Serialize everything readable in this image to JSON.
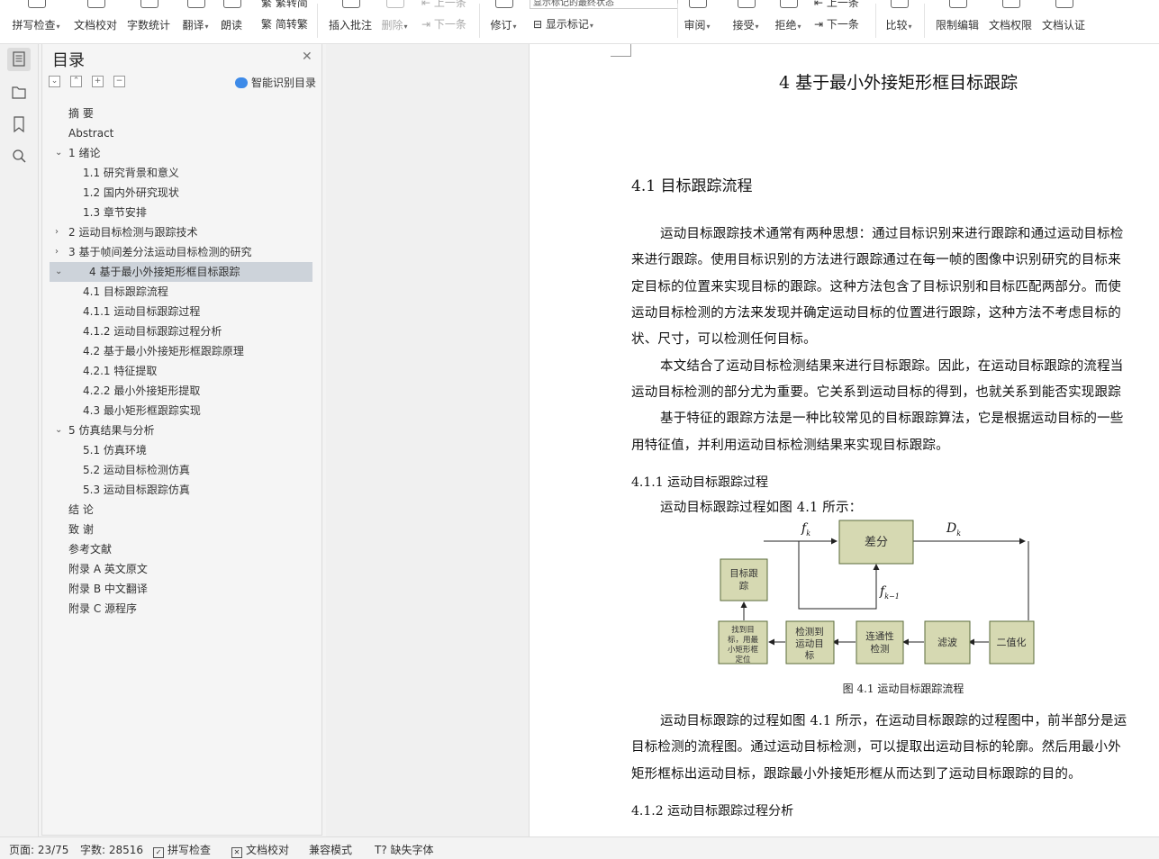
{
  "ribbon": {
    "spell_check": "拼写检查",
    "proofread": "文档校对",
    "word_count": "字数统计",
    "translate": "翻译",
    "read_aloud": "朗读",
    "simp_trad_top": "繁转简",
    "trad_to_simp": "简转繁",
    "insert_comment": "插入批注",
    "delete": "删除",
    "prev": "上一条",
    "next_comment": "下一条",
    "revise": "修订",
    "display_mode": "显示标记的最终状态",
    "show_marks": "显示标记",
    "review": "审阅",
    "accept": "接受",
    "reject": "拒绝",
    "prev_change": "上一条",
    "next_change": "下一条",
    "compare": "比较",
    "restrict": "限制编辑",
    "permission": "文档权限",
    "certify": "文档认证"
  },
  "toc": {
    "title": "目录",
    "smart_label": "智能识别目录",
    "items": [
      {
        "label": "摘  要",
        "toggle": ""
      },
      {
        "label": "Abstract",
        "toggle": ""
      },
      {
        "label": "1    绪论",
        "toggle": "v"
      },
      {
        "label": "1.1    研究背景和意义",
        "toggle": ""
      },
      {
        "label": "1.2    国内外研究现状",
        "toggle": ""
      },
      {
        "label": "1.3    章节安排",
        "toggle": ""
      },
      {
        "label": "2    运动目标检测与跟踪技术",
        "toggle": ">"
      },
      {
        "label": "3    基于帧间差分法运动目标检测的研究",
        "toggle": ">"
      },
      {
        "label": "4    基于最小外接矩形框目标跟踪",
        "toggle": "v"
      },
      {
        "label": "4.1    目标跟踪流程",
        "toggle": ""
      },
      {
        "label": "4.1.1    运动目标跟踪过程",
        "toggle": ""
      },
      {
        "label": "4.1.2    运动目标跟踪过程分析",
        "toggle": ""
      },
      {
        "label": "4.2    基于最小外接矩形框跟踪原理",
        "toggle": ""
      },
      {
        "label": "4.2.1    特征提取",
        "toggle": ""
      },
      {
        "label": "4.2.2    最小外接矩形提取",
        "toggle": ""
      },
      {
        "label": "4.3    最小矩形框跟踪实现",
        "toggle": ""
      },
      {
        "label": "5    仿真结果与分析",
        "toggle": "v"
      },
      {
        "label": "5.1    仿真环境",
        "toggle": ""
      },
      {
        "label": "5.2    运动目标检测仿真",
        "toggle": ""
      },
      {
        "label": "5.3    运动目标跟踪仿真",
        "toggle": ""
      },
      {
        "label": "结  论",
        "toggle": ""
      },
      {
        "label": "致  谢",
        "toggle": ""
      },
      {
        "label": "参考文献",
        "toggle": ""
      },
      {
        "label": "附录 A    英文原文",
        "toggle": ""
      },
      {
        "label": "附录 B    中文翻译",
        "toggle": ""
      },
      {
        "label": "附录 C    源程序",
        "toggle": ""
      }
    ]
  },
  "doc": {
    "chapter_title": "4    基于最小外接矩形框目标跟踪",
    "sec_41": "4.1    目标跟踪流程",
    "p1": [
      "运动目标跟踪技术通常有两种思想：通过目标识别来进行跟踪和通过运动目标检",
      "来进行跟踪。使用目标识别的方法进行跟踪通过在每一帧的图像中识别研究的目标来",
      "定目标的位置来实现目标的跟踪。这种方法包含了目标识别和目标匹配两部分。而使",
      "运动目标检测的方法来发现并确定运动目标的位置进行跟踪，这种方法不考虑目标的",
      "状、尺寸，可以检测任何目标。"
    ],
    "p2": [
      "本文结合了运动目标检测结果来进行目标跟踪。因此，在运动目标跟踪的流程当",
      "运动目标检测的部分尤为重要。它关系到运动目标的得到，也就关系到能否实现跟踪"
    ],
    "p3": [
      "基于特征的跟踪方法是一种比较常见的目标跟踪算法，它是根据运动目标的一些",
      "用特征值，并利用运动目标检测结果来实现目标跟踪。"
    ],
    "sec_411": "4.1.1    运动目标跟踪过程",
    "p4": "运动目标跟踪过程如图 4.1 所示：",
    "figure": {
      "fk": "f",
      "fk_sub": "k",
      "dk": "D",
      "dk_sub": "k",
      "fk1": "f",
      "fk1_sub": "k−1",
      "diff": "差分",
      "target_track_1": "目标跟",
      "target_track_2": "踪",
      "find_1": "找到目",
      "find_2": "标，用最",
      "find_3": "小矩形框",
      "find_4": "定位",
      "detect_1": "检测到",
      "detect_2": "运动目",
      "detect_3": "标",
      "conn_1": "连通性",
      "conn_2": "检测",
      "filter": "滤波",
      "binarize": "二值化",
      "caption": "图 4.1  运动目标跟踪流程"
    },
    "p5": [
      "运动目标跟踪的过程如图 4.1 所示，在运动目标跟踪的过程图中，前半部分是运",
      "目标检测的流程图。通过运动目标检测，可以提取出运动目标的轮廓。然后用最小外",
      "矩形框标出运动目标，跟踪最小外接矩形框从而达到了运动目标跟踪的目的。"
    ],
    "sec_412": "4.1.2    运动目标跟踪过程分析"
  },
  "status": {
    "page": "页面: 23/75",
    "words": "字数: 28516",
    "spell": "拼写检查",
    "proof": "文档校对",
    "compat": "兼容模式",
    "missing_font": "缺失字体"
  }
}
